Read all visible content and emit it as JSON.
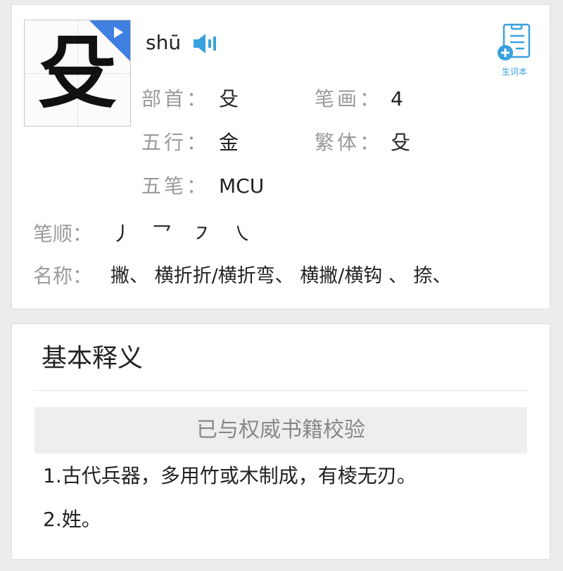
{
  "character": {
    "glyph": "殳",
    "pinyin": "shū"
  },
  "vocab": {
    "label": "生词本"
  },
  "info": [
    {
      "label": "部首：",
      "value": "殳"
    },
    {
      "label": "笔画：",
      "value": "4"
    },
    {
      "label": "五行：",
      "value": "金"
    },
    {
      "label": "繁体：",
      "value": "殳"
    },
    {
      "label": "五笔：",
      "value": "MCU"
    }
  ],
  "strokes": {
    "order_label": "笔顺：",
    "order": [
      "丿",
      "乛",
      "㇇",
      "㇏"
    ],
    "names_label": "名称：",
    "names": "撇、 横折折/横折弯、 横撇/横钩 、 捺、"
  },
  "definition": {
    "title": "基本释义",
    "verified": "已与权威书籍校验",
    "items": [
      "1.古代兵器，多用竹或木制成，有棱无刃。",
      "2.姓。"
    ]
  },
  "colors": {
    "accent_blue": "#3f7fe0",
    "speaker_blue": "#3aa0de",
    "label_gray": "#9a9a9a"
  }
}
